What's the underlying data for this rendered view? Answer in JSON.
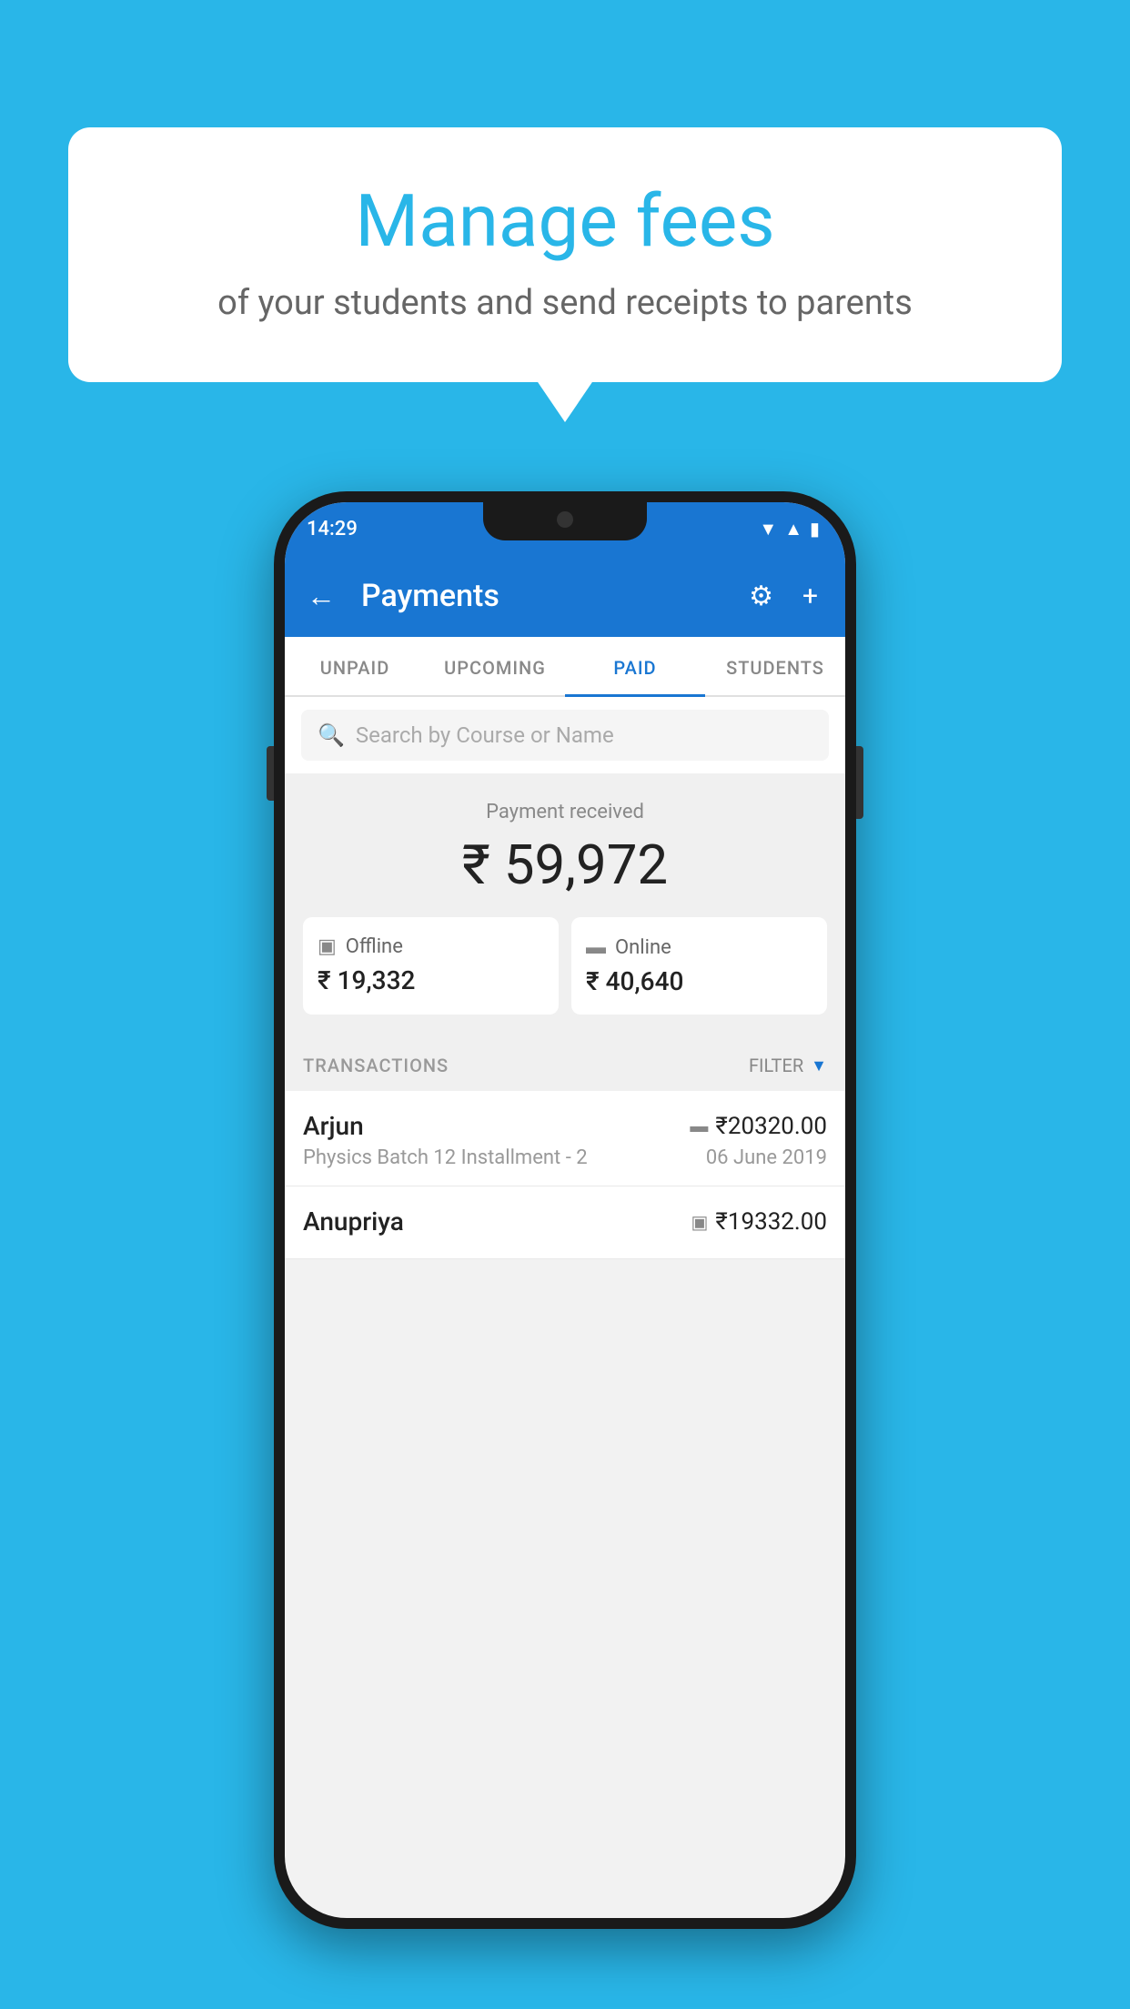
{
  "background": {
    "color": "#29b6e8"
  },
  "bubble": {
    "title": "Manage fees",
    "subtitle": "of your students and send receipts to parents"
  },
  "phone": {
    "statusBar": {
      "time": "14:29"
    },
    "appBar": {
      "title": "Payments",
      "backLabel": "←",
      "gearLabel": "⚙",
      "plusLabel": "+"
    },
    "tabs": [
      {
        "label": "UNPAID",
        "active": false
      },
      {
        "label": "UPCOMING",
        "active": false
      },
      {
        "label": "PAID",
        "active": true
      },
      {
        "label": "STUDENTS",
        "active": false
      }
    ],
    "search": {
      "placeholder": "Search by Course or Name"
    },
    "paymentReceived": {
      "label": "Payment received",
      "amount": "₹ 59,972",
      "offline": {
        "label": "Offline",
        "amount": "₹ 19,332"
      },
      "online": {
        "label": "Online",
        "amount": "₹ 40,640"
      }
    },
    "transactions": {
      "header": "TRANSACTIONS",
      "filterLabel": "FILTER",
      "rows": [
        {
          "name": "Arjun",
          "amount": "₹20320.00",
          "desc": "Physics Batch 12 Installment - 2",
          "date": "06 June 2019",
          "type": "online"
        },
        {
          "name": "Anupriya",
          "amount": "₹19332.00",
          "desc": "",
          "date": "",
          "type": "offline"
        }
      ]
    }
  }
}
